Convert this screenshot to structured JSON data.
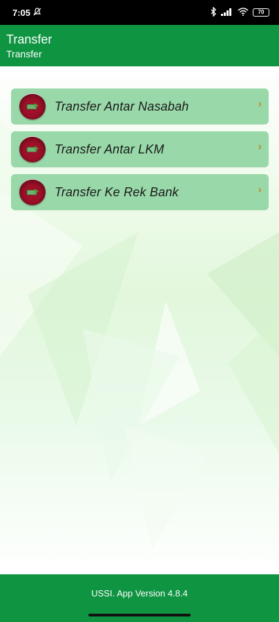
{
  "status_bar": {
    "time": "7:05",
    "battery": "70"
  },
  "app_bar": {
    "title": "Transfer",
    "subtitle": "Transfer"
  },
  "menu": {
    "items": [
      {
        "label": "Transfer Antar Nasabah"
      },
      {
        "label": "Transfer Antar LKM"
      },
      {
        "label": "Transfer Ke Rek Bank"
      }
    ]
  },
  "footer": {
    "version_text": "USSI. App Version 4.8.4"
  },
  "colors": {
    "primary_green": "#0f9442",
    "menu_item_bg": "#99d8a8",
    "chevron": "#c48a2a",
    "icon_red": "#9a0f27"
  }
}
